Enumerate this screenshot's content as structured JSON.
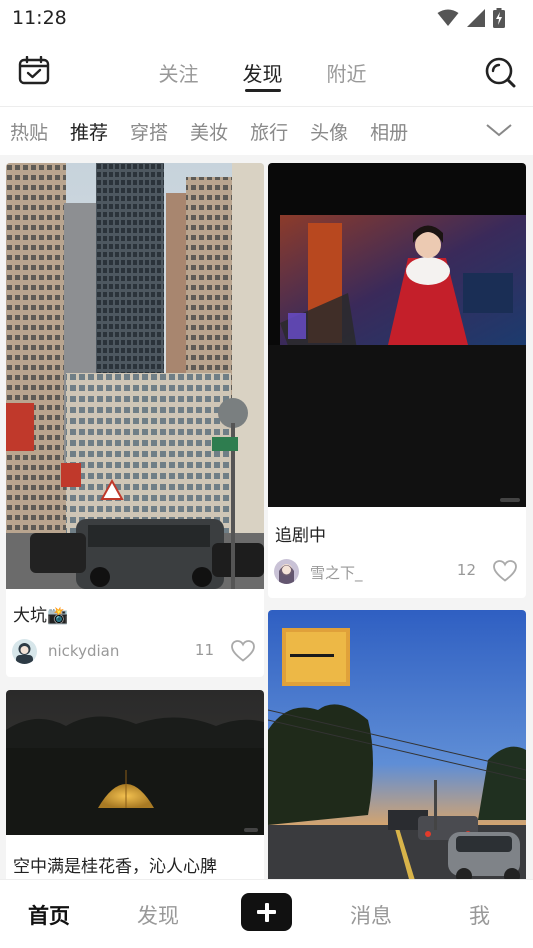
{
  "status_bar": {
    "time": "11:28",
    "icons": [
      "wifi-icon",
      "signal-icon",
      "battery-charging-icon"
    ]
  },
  "top_nav": {
    "left_icon": "calendar-check-icon",
    "right_icon": "search-icon",
    "tabs": [
      {
        "label": "关注",
        "active": false
      },
      {
        "label": "发现",
        "active": true
      },
      {
        "label": "附近",
        "active": false
      }
    ]
  },
  "categories": {
    "items": [
      {
        "label": "热贴",
        "active": false
      },
      {
        "label": "推荐",
        "active": true
      },
      {
        "label": "穿搭",
        "active": false
      },
      {
        "label": "美妆",
        "active": false
      },
      {
        "label": "旅行",
        "active": false
      },
      {
        "label": "头像",
        "active": false
      },
      {
        "label": "相册",
        "active": false
      }
    ],
    "expand_icon": "chevron-down-icon"
  },
  "feed": {
    "cards": [
      {
        "title": "大坑📸",
        "author": "nickydian",
        "likes": "11",
        "image": "city-street-buildings-photo"
      },
      {
        "title": "追剧中",
        "author": "雪之下_",
        "likes": "12",
        "image": "drama-screen-photo"
      },
      {
        "title": "空中满是桂花香，沁人心脾",
        "author": "",
        "likes": "",
        "image": "night-tent-photo"
      },
      {
        "title": "",
        "author": "",
        "likes": "",
        "image": "sunset-road-photo"
      }
    ]
  },
  "bottom_bar": {
    "items": [
      {
        "label": "首页",
        "active": true
      },
      {
        "label": "发现",
        "active": false
      },
      {
        "label": "消息",
        "active": false
      },
      {
        "label": "我",
        "active": false
      }
    ],
    "add_icon": "plus-icon"
  },
  "colors": {
    "text_primary": "#222222",
    "text_secondary": "#999999",
    "feed_background": "#f4f4f4",
    "add_button": "#111111"
  }
}
